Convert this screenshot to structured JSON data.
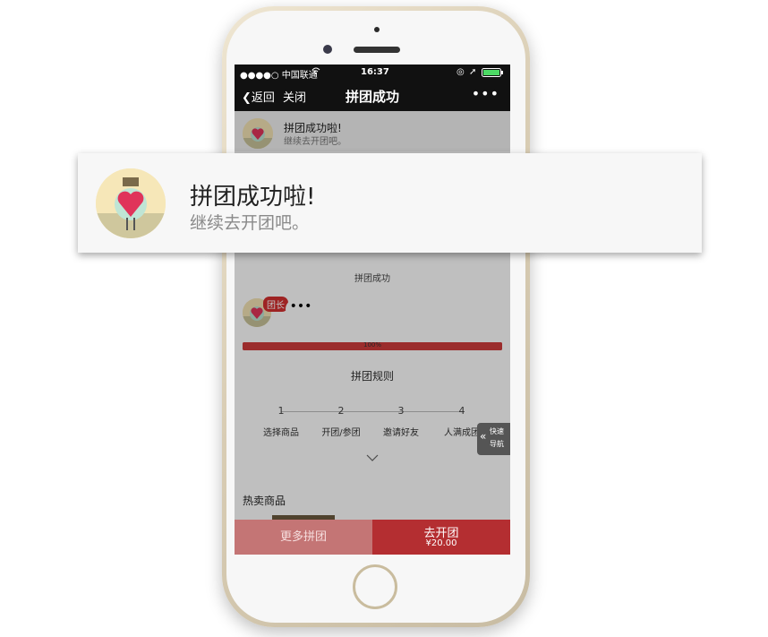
{
  "status_bar": {
    "carrier": "●●●●○ 中国联通",
    "time": "16:37"
  },
  "nav": {
    "back": "返回",
    "close": "关闭",
    "title": "拼团成功",
    "more": "•••"
  },
  "header": {
    "title": "拼团成功啦!",
    "subtitle": "继续去开团吧。"
  },
  "group": {
    "status": "拼团成功",
    "leader_badge": "团长",
    "more": "•••",
    "progress": 1.0,
    "progress_label": "100%"
  },
  "rules": {
    "title": "拼团规则",
    "steps": [
      {
        "num": "1",
        "label": "选择商品"
      },
      {
        "num": "2",
        "label": "开团/参团"
      },
      {
        "num": "3",
        "label": "邀请好友"
      },
      {
        "num": "4",
        "label": "人满成团"
      }
    ]
  },
  "quick_nav": {
    "line1": "快速",
    "line2": "导航"
  },
  "hot": {
    "title": "热卖商品"
  },
  "bottom": {
    "more_label": "更多拼团",
    "open_label": "去开团",
    "price": "¥20.00"
  },
  "colors": {
    "accent_red": "#b42e31",
    "progress_red": "#cf3b3b",
    "nav_black": "#111111"
  }
}
